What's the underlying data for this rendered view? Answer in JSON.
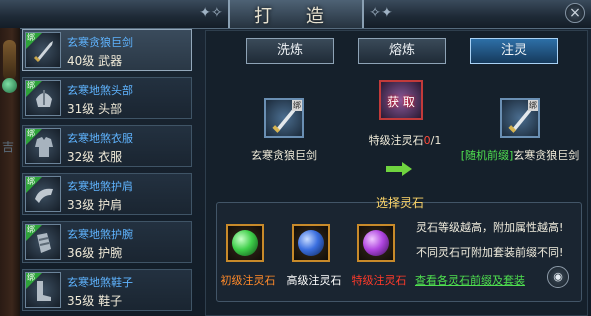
{
  "window": {
    "title": "打 造",
    "close_glyph": "×"
  },
  "sidebar": {
    "side_text": "吉",
    "items": [
      {
        "name": "玄寒贪狼巨剑",
        "level": "40级 武器",
        "badge": "绑",
        "icon": "sword-icon",
        "selected": true
      },
      {
        "name": "玄寒地煞头部",
        "level": "31级 头部",
        "badge": "绑",
        "icon": "helmet-icon",
        "selected": false
      },
      {
        "name": "玄寒地煞衣服",
        "level": "32级 衣服",
        "badge": "绑",
        "icon": "armor-icon",
        "selected": false
      },
      {
        "name": "玄寒地煞护肩",
        "level": "33级 护肩",
        "badge": "绑",
        "icon": "shoulder-icon",
        "selected": false
      },
      {
        "name": "玄寒地煞护腕",
        "level": "36级 护腕",
        "badge": "绑",
        "icon": "bracer-icon",
        "selected": false
      },
      {
        "name": "玄寒地煞鞋子",
        "level": "35级 鞋子",
        "badge": "绑",
        "icon": "boots-icon",
        "selected": false
      }
    ]
  },
  "tabs": [
    {
      "label": "洗炼",
      "active": false
    },
    {
      "label": "熔炼",
      "active": false
    },
    {
      "label": "注灵",
      "active": true
    }
  ],
  "infuse": {
    "source_item": {
      "label": "玄寒贪狼巨剑",
      "badge": "绑"
    },
    "material": {
      "overlay": "获 取",
      "label_prefix": "特级注灵石",
      "count_have": "0",
      "count_total": "/1"
    },
    "result_item": {
      "label_prefix": "[随机前缀]",
      "label": "玄寒贪狼巨剑",
      "badge": "绑"
    }
  },
  "stone_section": {
    "title": "选择灵石",
    "stones": [
      {
        "label": "初级注灵石",
        "color": "#ff8a2a",
        "gem_color": "#3fcf4a"
      },
      {
        "label": "高级注灵石",
        "color": "#ffffff",
        "gem_color": "#3b6fe0"
      },
      {
        "label": "特级注灵石",
        "color": "#ff3a2a",
        "gem_color": "#b046e0"
      }
    ],
    "desc1": "灵石等级越高，附加属性越高!",
    "desc2": "不同灵石可附加套装前缀不同!",
    "link": "查看各灵石前缀及套装",
    "eye_glyph": "◉"
  }
}
